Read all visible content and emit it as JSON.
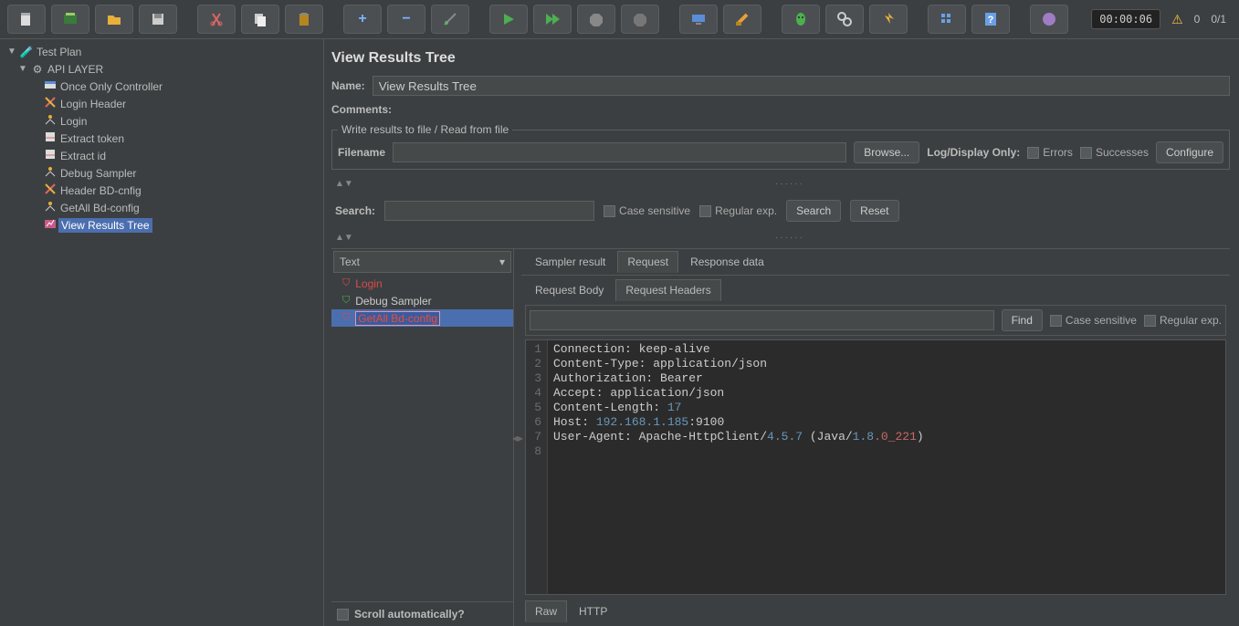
{
  "toolbar": {
    "timer": "00:00:06",
    "warn_count": "0",
    "thread_ratio": "0/1"
  },
  "tree": {
    "root": "Test Plan",
    "group": "API LAYER",
    "items": [
      "Once Only Controller",
      "Login Header",
      "Login",
      "Extract token",
      "Extract id",
      "Debug Sampler",
      " Header  BD-cnfig",
      "GetAll Bd-config",
      "View Results Tree"
    ]
  },
  "panel": {
    "title": "View Results Tree",
    "name_label": "Name:",
    "name_value": "View Results Tree",
    "comments_label": "Comments:",
    "file_legend": "Write results to file / Read from file",
    "filename_label": "Filename",
    "browse": "Browse...",
    "log_display": "Log/Display Only:",
    "errors": "Errors",
    "successes": "Successes",
    "configure": "Configure"
  },
  "search": {
    "label": "Search:",
    "case": "Case sensitive",
    "regex": "Regular exp.",
    "search_btn": "Search",
    "reset_btn": "Reset"
  },
  "results": {
    "renderer": "Text",
    "items": [
      {
        "label": "Login",
        "status": "fail"
      },
      {
        "label": "Debug Sampler",
        "status": "pass"
      },
      {
        "label": "GetAll Bd-config",
        "status": "fail",
        "selected": true
      }
    ],
    "scroll_auto": "Scroll automatically?"
  },
  "tabs": {
    "sampler": "Sampler result",
    "request": "Request",
    "response": "Response data",
    "req_body": "Request Body",
    "req_headers": "Request Headers",
    "raw": "Raw",
    "http": "HTTP",
    "find": "Find",
    "case": "Case sensitive",
    "regex": "Regular exp."
  },
  "headers": [
    {
      "n": "1",
      "text": "Connection: keep-alive"
    },
    {
      "n": "2",
      "text": "Content-Type: application/json"
    },
    {
      "n": "3",
      "text": "Authorization: Bearer"
    },
    {
      "n": "4",
      "text": "Accept: application/json"
    },
    {
      "n": "5",
      "text": "Content-Length: ",
      "num": "17"
    },
    {
      "n": "6",
      "text": "Host: ",
      "num": "192.168.1.185",
      "suffix": ":9100"
    },
    {
      "n": "7",
      "ua_a": "User-Agent: Apache-HttpClient/",
      "ua_v1": "4.5.7",
      "ua_b": " (Java/",
      "ua_v2": "1.8",
      "ua_err": ".0_221",
      "ua_c": ")"
    },
    {
      "n": "8",
      "text": ""
    }
  ]
}
